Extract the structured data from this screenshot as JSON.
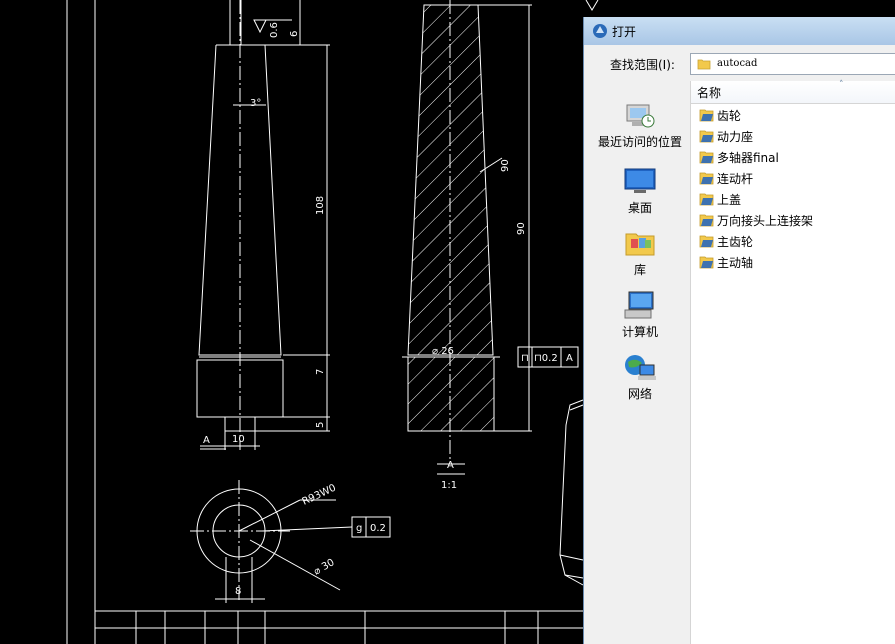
{
  "cad": {
    "dims": {
      "taper_angle": "3°",
      "len_108": "108",
      "len_7": "7",
      "len_5": "5",
      "dim_10": "10",
      "dim_6_top": "6",
      "roughness_top": "0.6",
      "section_A_left": "A",
      "section_A_bottom": "A",
      "section_scale": "1:1",
      "dim_90": "90",
      "dim_90_angle": "90",
      "dia_26": "⌀ 26",
      "tol_symbol": "⊓",
      "tol_value": "⊓0.2",
      "tol_datum": "A",
      "circ_tol_symbol": "g",
      "circ_tol_value": "0.2",
      "dim_r": "R93W0",
      "dia_30": "⌀ 30",
      "dim_8": "8"
    }
  },
  "dialog": {
    "title": "打开",
    "look_in_label": "查找范围(I):",
    "look_in_value": "autocad",
    "places": [
      {
        "label": "最近访问的位置",
        "icon": "recent-places-icon"
      },
      {
        "label": "桌面",
        "icon": "desktop-icon"
      },
      {
        "label": "库",
        "icon": "libraries-icon"
      },
      {
        "label": "计算机",
        "icon": "computer-icon"
      },
      {
        "label": "网络",
        "icon": "network-icon"
      }
    ],
    "column_name": "名称",
    "files": [
      "齿轮",
      "动力座",
      "多轴器final",
      "连动杆",
      "上盖",
      "万向接头上连接架",
      "主齿轮",
      "主动轴"
    ]
  },
  "colors": {
    "cad_background": "#000000",
    "cad_lines": "#ffffff",
    "dialog_title_gradient": "#b9d3ee",
    "folder_yellow": "#f2c94c"
  }
}
